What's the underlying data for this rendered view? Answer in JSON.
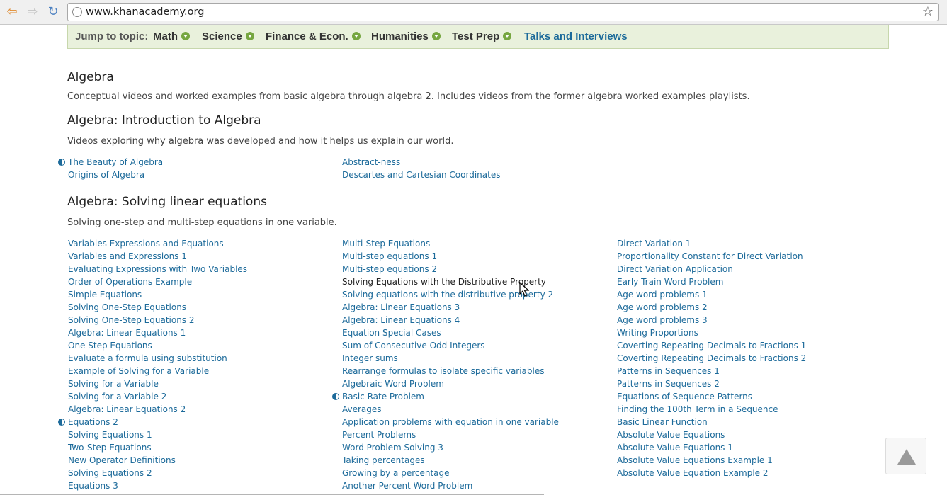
{
  "browser": {
    "url": "www.khanacademy.org"
  },
  "topic_bar": {
    "label": "Jump to topic:",
    "topics": [
      "Math",
      "Science",
      "Finance & Econ.",
      "Humanities",
      "Test Prep"
    ],
    "talks": "Talks and Interviews"
  },
  "algebra": {
    "title": "Algebra",
    "description": "Conceptual videos and worked examples from basic algebra through algebra 2. Includes videos from the former algebra worked examples playlists."
  },
  "intro": {
    "title": "Algebra: Introduction to Algebra",
    "description": "Videos exploring why algebra was developed and how it helps us explain our world.",
    "col1": [
      "The Beauty of Algebra",
      "Origins of Algebra"
    ],
    "col2": [
      "Abstract-ness",
      "Descartes and Cartesian Coordinates"
    ]
  },
  "linear": {
    "title": "Algebra: Solving linear equations",
    "description": "Solving one-step and multi-step equations in one variable.",
    "col1": [
      "Variables Expressions and Equations",
      "Variables and Expressions 1",
      "Evaluating Expressions with Two Variables",
      "Order of Operations Example",
      "Simple Equations",
      "Solving One-Step Equations",
      "Solving One-Step Equations 2",
      "Algebra: Linear Equations 1",
      "One Step Equations",
      "Evaluate a formula using substitution",
      "Example of Solving for a Variable",
      "Solving for a Variable",
      "Solving for a Variable 2",
      "Algebra: Linear Equations 2",
      "Equations 2",
      "Solving Equations 1",
      "Two-Step Equations",
      "New Operator Definitions",
      "Solving Equations 2",
      "Equations 3"
    ],
    "col2": [
      "Multi-Step Equations",
      "Multi-step equations 1",
      "Multi-step equations 2",
      "Solving Equations with the Distributive Property",
      "Solving equations with the distributive property 2",
      "Algebra: Linear Equations 3",
      "Algebra: Linear Equations 4",
      "Equation Special Cases",
      "Sum of Consecutive Odd Integers",
      "Integer sums",
      "Rearrange formulas to isolate specific variables",
      "Algebraic Word Problem",
      "Basic Rate Problem",
      "Averages",
      "Application problems with equation in one variable",
      "Percent Problems",
      "Word Problem Solving 3",
      "Taking percentages",
      "Growing by a percentage",
      "Another Percent Word Problem"
    ],
    "col3": [
      "Direct Variation 1",
      "Proportionality Constant for Direct Variation",
      "Direct Variation Application",
      "Early Train Word Problem",
      "Age word problems 1",
      "Age word problems 2",
      "Age word problems 3",
      "Writing Proportions",
      "Coverting Repeating Decimals to Fractions 1",
      "Coverting Repeating Decimals to Fractions 2",
      "Patterns in Sequences 1",
      "Patterns in Sequences 2",
      "Equations of Sequence Patterns",
      "Finding the 100th Term in a Sequence",
      "Basic Linear Function",
      "Absolute Value Equations",
      "Absolute Value Equations 1",
      "Absolute Value Equations Example 1",
      "Absolute Value Equation Example 2"
    ]
  },
  "colors": {
    "link": "#1c6a9a",
    "topic_bar_bg": "#e9f1dc",
    "caret_green": "#76a640"
  }
}
